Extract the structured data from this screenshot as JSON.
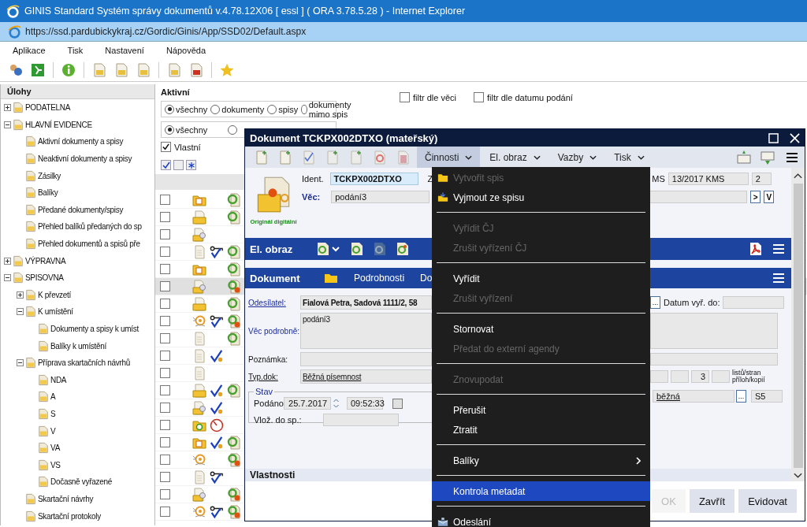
{
  "browser": {
    "title": "GINIS Standard Systém správy dokumentů v.4.78.12X06 [ essl ] ( ORA 3.78.5.28 ) - Internet Explorer",
    "url": "https://ssd.pardubickykraj.cz/Gordic/Ginis/App/SSD02/Default.aspx"
  },
  "menu": [
    "Aplikace",
    "Tisk",
    "Nastavení",
    "Nápověda"
  ],
  "tasks": {
    "title": "Úlohy",
    "tree": [
      {
        "label": "PODATELNA",
        "expanded": false
      },
      {
        "label": "HLAVNÍ EVIDENCE",
        "expanded": true,
        "children": [
          {
            "label": "Aktivní dokumenty a spisy"
          },
          {
            "label": "Neaktivní dokumenty a spisy"
          },
          {
            "label": "Zásilky"
          },
          {
            "label": "Balíky"
          },
          {
            "label": "Předané dokumenty/spisy"
          },
          {
            "label": "Přehled balíků předaných do sp"
          },
          {
            "label": "Přehled dokumentů a spisů pře"
          }
        ]
      },
      {
        "label": "VÝPRAVNA",
        "expanded": false
      },
      {
        "label": "SPISOVNA",
        "expanded": true,
        "children": [
          {
            "label": "K převzetí",
            "expanded": false
          },
          {
            "label": "K umístění",
            "expanded": true,
            "children": [
              {
                "label": "Dokumenty a spisy k umíst"
              },
              {
                "label": "Balíky k umístění"
              }
            ]
          },
          {
            "label": "Příprava skartačních návrhů",
            "expanded": true,
            "children": [
              {
                "label": "NDA"
              },
              {
                "label": "A"
              },
              {
                "label": "S"
              },
              {
                "label": "V"
              },
              {
                "label": "VA"
              },
              {
                "label": "VS"
              },
              {
                "label": "Dočasně vyřazené"
              }
            ]
          },
          {
            "label": "Skartační návrhy"
          },
          {
            "label": "Skartační protokoly"
          }
        ]
      }
    ]
  },
  "filters": {
    "title": "Aktivní",
    "type_options": [
      {
        "label": "všechny",
        "selected": true
      },
      {
        "label": "dokumenty",
        "selected": false
      },
      {
        "label": "spisy",
        "selected": false
      },
      {
        "label": "dokumenty mimo spis",
        "selected": false
      }
    ],
    "state_options": [
      {
        "label": "všechny",
        "selected": true
      },
      {
        "selected": false
      }
    ],
    "checks": [
      {
        "label": "filtr dle věci",
        "checked": false
      },
      {
        "label": "filtr dle datumu podání",
        "checked": false
      }
    ],
    "own": {
      "label": "Vlastní",
      "checked": true
    }
  },
  "grid": {
    "rows": [
      {
        "selected": false,
        "checked": false
      },
      {
        "selected": false,
        "checked": false
      },
      {
        "selected": false,
        "checked": false
      },
      {
        "selected": false,
        "checked": false
      },
      {
        "selected": false,
        "checked": false
      },
      {
        "selected": true,
        "checked": false
      },
      {
        "selected": false,
        "checked": false
      },
      {
        "selected": false,
        "checked": false
      },
      {
        "selected": false,
        "checked": false
      },
      {
        "selected": false,
        "checked": false
      },
      {
        "selected": false,
        "checked": false
      },
      {
        "selected": false,
        "checked": false
      },
      {
        "selected": false,
        "checked": false
      },
      {
        "selected": false,
        "checked": false
      },
      {
        "selected": false,
        "checked": false
      },
      {
        "selected": false,
        "checked": false
      },
      {
        "selected": false,
        "checked": false
      },
      {
        "selected": false,
        "checked": false
      },
      {
        "selected": false,
        "checked": false
      }
    ]
  },
  "dialog": {
    "title": "Dokument TCKPX002DTXO (mateřský)",
    "tabs": [
      {
        "label": "Činnosti",
        "selected": true
      },
      {
        "label": "El. obraz",
        "selected": false
      },
      {
        "label": "Vazby",
        "selected": false
      },
      {
        "label": "Tisk",
        "selected": false
      }
    ],
    "original_label": "Originál digitální",
    "ident_label": "Ident.",
    "ident": "TCKPX002DTXO",
    "ident_next_label": "Z",
    "number_label": "MS",
    "number": "13/2017 KMS",
    "count": "2",
    "subject_label": "Věc:",
    "subject": "podání3",
    "next_button": ">",
    "v_button": "V",
    "image_bar": "El. obraz",
    "doc_bar": "Dokument",
    "doc_tabs": [
      "Podrobnosti",
      "Do"
    ],
    "sender_label": "Odesílatel:",
    "sender": "Fialová Petra, Sadová 1111/2, 58",
    "dots": "...",
    "due_label": "Datum vyř. do:",
    "detail_label": "Věc podrobně:",
    "detail": "podání3",
    "note_label": "Poznámka:",
    "type_label": "Typ.dok:",
    "type": "Běžná písemnost",
    "sheets": "3",
    "sheets_label": "listů/stran",
    "attach_label": "příloh/kopií",
    "state_title": "Stav",
    "filed_label": "Podáno:",
    "filed_date": "25.7.2017",
    "filed_time": "09:52:33",
    "filed_flag": false,
    "inserted_label": "Vlož. do sp.:",
    "mode": "běžná",
    "mode_dots": "...",
    "shred": "S5",
    "section": "Vlastnosti",
    "buttons": [
      {
        "label": "OK",
        "disabled": true
      },
      {
        "label": "Zavřít",
        "disabled": false
      },
      {
        "label": "Evidovat",
        "disabled": false
      }
    ]
  },
  "actions": [
    {
      "kind": "item",
      "label": "Vytvořit spis",
      "disabled": true,
      "selected": false
    },
    {
      "kind": "item",
      "label": "Vyjmout ze spisu",
      "disabled": false,
      "selected": false
    },
    {
      "kind": "separator"
    },
    {
      "kind": "item",
      "label": "Vyřídit ČJ",
      "disabled": true,
      "selected": false
    },
    {
      "kind": "item",
      "label": "Zrušit vyřízení ČJ",
      "disabled": true,
      "selected": false
    },
    {
      "kind": "separator"
    },
    {
      "kind": "item",
      "label": "Vyřídit",
      "disabled": false,
      "selected": false
    },
    {
      "kind": "item",
      "label": "Zrušit vyřízení",
      "disabled": true,
      "selected": false
    },
    {
      "kind": "separator"
    },
    {
      "kind": "item",
      "label": "Stornovat",
      "disabled": false,
      "selected": false
    },
    {
      "kind": "item",
      "label": "Předat do externí agendy",
      "disabled": true,
      "selected": false
    },
    {
      "kind": "separator"
    },
    {
      "kind": "item",
      "label": "Znovupodat",
      "disabled": true,
      "selected": false
    },
    {
      "kind": "separator"
    },
    {
      "kind": "item",
      "label": "Přerušit",
      "disabled": false,
      "selected": false
    },
    {
      "kind": "item",
      "label": "Ztratit",
      "disabled": false,
      "selected": false
    },
    {
      "kind": "separator"
    },
    {
      "kind": "submenu",
      "label": "Balíky",
      "disabled": false,
      "selected": false
    },
    {
      "kind": "separator"
    },
    {
      "kind": "item",
      "label": "Kontrola metadat",
      "disabled": false,
      "selected": true
    },
    {
      "kind": "separator"
    },
    {
      "kind": "item",
      "label": "Odeslání",
      "disabled": false,
      "selected": false
    }
  ]
}
